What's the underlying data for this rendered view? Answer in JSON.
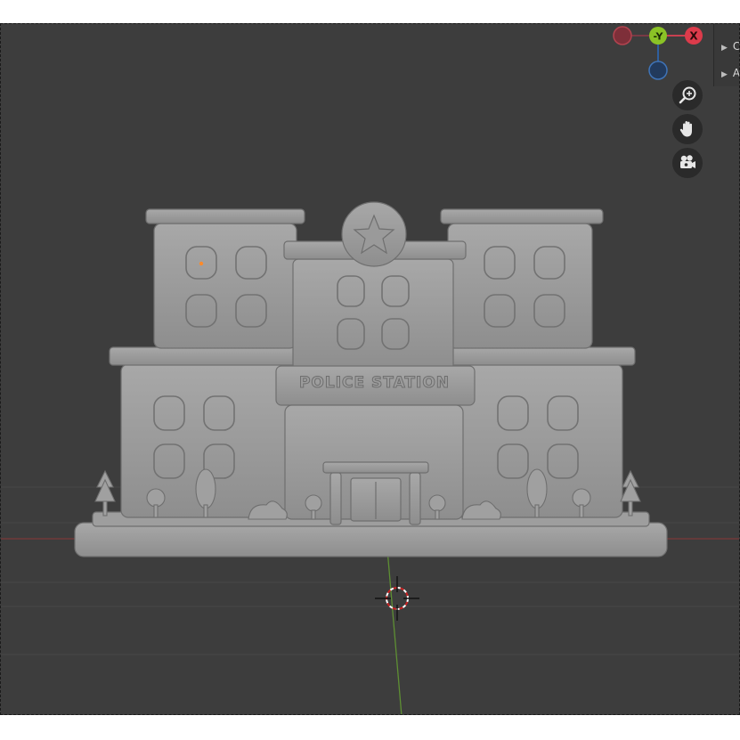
{
  "gizmo": {
    "x_label": "X",
    "y_label": "-Y",
    "colors": {
      "x": "#dc3b4b",
      "x_neg": "#9c3a44",
      "y": "#8bc326",
      "z_neg": "#2f5f9e"
    }
  },
  "side_panel": {
    "items": [
      {
        "label": "C",
        "icon": "expand-triangle-icon"
      },
      {
        "label": "A",
        "icon": "expand-triangle-icon"
      }
    ]
  },
  "navigation": {
    "zoom": {
      "icon": "zoom-icon"
    },
    "pan": {
      "icon": "hand-pan-icon"
    },
    "camera": {
      "icon": "camera-icon"
    }
  },
  "model": {
    "sign_text": "POLICE STATION",
    "emblem": "star-icon"
  },
  "colors": {
    "viewport_bg": "#3d3d3d",
    "model": "#9a9a9a",
    "x_axis": "#8a3a3a",
    "y_axis": "#5f8a3a"
  }
}
